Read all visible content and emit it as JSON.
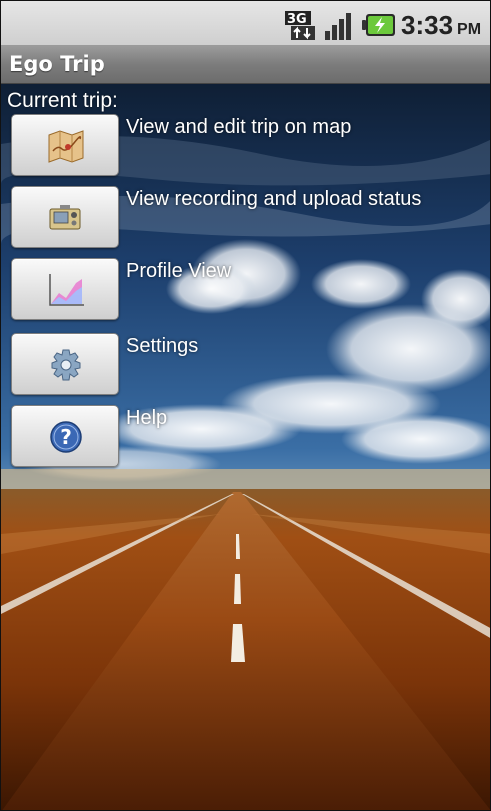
{
  "status_bar": {
    "network_icon": "3g-data-icon",
    "signal_icon": "signal-strength-icon",
    "battery_icon": "battery-charging-icon",
    "time": "3:33",
    "ampm": "PM"
  },
  "app": {
    "title": "Ego Trip"
  },
  "main": {
    "section_label": "Current trip:",
    "items": [
      {
        "label": "View and edit trip on map",
        "icon": "map-icon"
      },
      {
        "label": "View recording and upload status",
        "icon": "recorder-icon"
      },
      {
        "label": "Profile View",
        "icon": "chart-icon"
      },
      {
        "label": "Settings",
        "icon": "gear-icon"
      },
      {
        "label": "Help",
        "icon": "help-icon"
      }
    ]
  },
  "colors": {
    "title_bar": "#7c7c7c",
    "status_bar": "#d9d9d9",
    "label_text": "#ffffff",
    "battery_accent": "#6cc93c"
  }
}
